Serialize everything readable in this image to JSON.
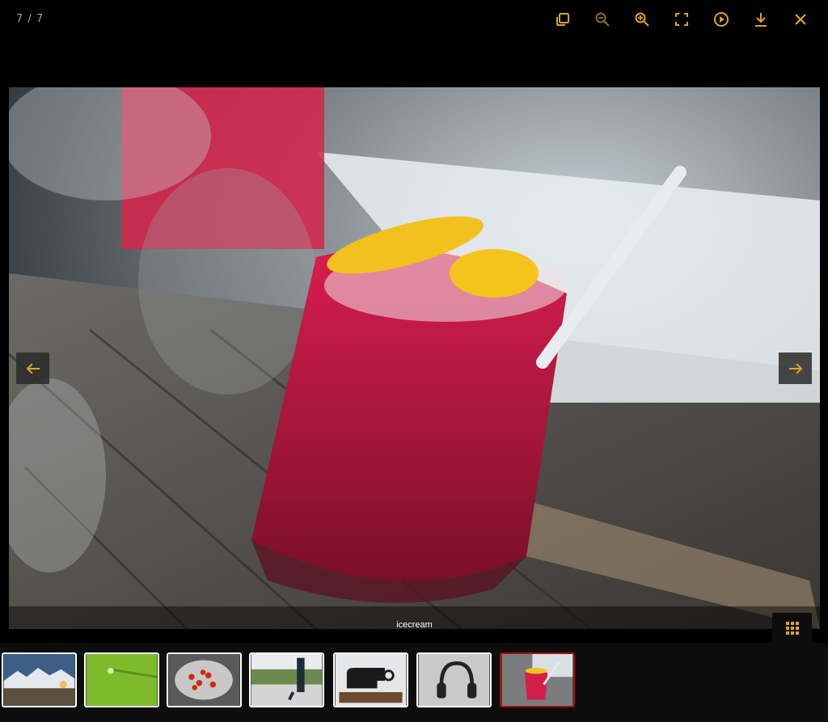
{
  "viewer": {
    "counter": "7 / 7",
    "caption": "icecream",
    "toolbar": [
      {
        "icon": "copy-icon"
      },
      {
        "icon": "zoom-out-icon"
      },
      {
        "icon": "zoom-in-icon"
      },
      {
        "icon": "fullscreen-icon"
      },
      {
        "icon": "play-icon"
      },
      {
        "icon": "download-icon"
      },
      {
        "icon": "close-icon"
      }
    ],
    "accent_color": "#d9a52a",
    "active_thumb_border": "#a50f0f",
    "thumbnails": [
      {
        "name": "mountains-lake-thumbnail"
      },
      {
        "name": "green-leaf-drop-thumbnail"
      },
      {
        "name": "berries-bowl-thumbnail"
      },
      {
        "name": "park-walking-thumbnail"
      },
      {
        "name": "sewing-machine-thumbnail"
      },
      {
        "name": "headphones-thumbnail"
      },
      {
        "name": "icecream-thumbnail",
        "active": true
      }
    ]
  }
}
